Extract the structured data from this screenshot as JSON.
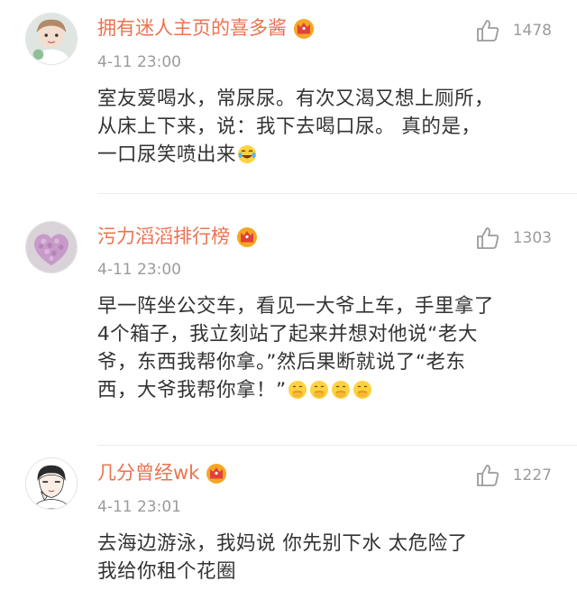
{
  "colors": {
    "username": "#eb7350",
    "secondary_text": "#9b9b9b",
    "body_text": "#333333",
    "divider": "#ececec",
    "crown_gold": "#f5a623",
    "crown_red": "#e0413a"
  },
  "comments": [
    {
      "username": "拥有迷人主页的喜多酱",
      "badge_icon": "vip-crown-icon",
      "time": "4-11 23:00",
      "likes": "1478",
      "text_lines": [
        "室友爱喝水，常尿尿。有次又渴又想上厕所，",
        "从床上下来，说：我下去喝口尿。 真的是，",
        "一口尿笑喷出来"
      ],
      "trailing_emoji_icon": "laugh-cry-emoji-icon"
    },
    {
      "username": "污力滔滔排行榜",
      "badge_icon": "vip-crown-icon",
      "time": "4-11 23:00",
      "likes": "1303",
      "text_lines": [
        "早一阵坐公交车，看见一大爷上车，手里拿了",
        "4个箱子，我立刻站了起来并想对他说“老大",
        "爷，东西我帮你拿。”然后果断就说了“老东",
        "西，大爷我帮你拿！”"
      ],
      "trailing_emoji_icon": "holding-mouth-emoji-icon"
    },
    {
      "username": "几分曾经wk",
      "badge_icon": "vip-crown-icon",
      "time": "4-11 23:01",
      "likes": "1227",
      "text_lines": [
        "去海边游泳，我妈说  你先别下水  太危险了",
        "我给你租个花圈"
      ]
    }
  ]
}
